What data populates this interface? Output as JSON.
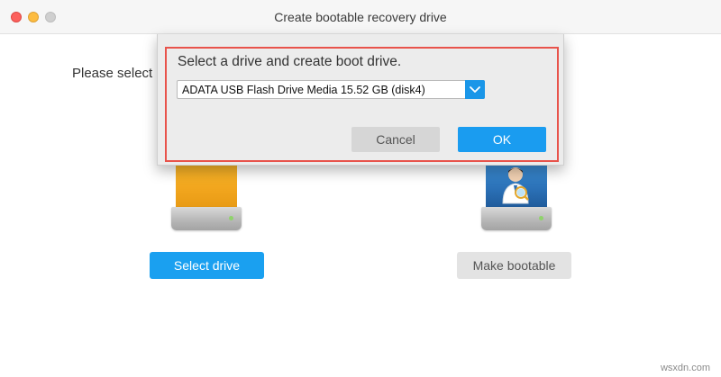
{
  "window": {
    "title": "Create bootable recovery drive"
  },
  "main": {
    "prompt": "Please select",
    "select_drive_label": "Select drive",
    "make_bootable_label": "Make bootable"
  },
  "dialog": {
    "heading": "Select a drive and create boot drive.",
    "drive_dropdown": {
      "selected": "ADATA USB Flash Drive Media 15.52 GB (disk4)"
    },
    "cancel_label": "Cancel",
    "ok_label": "OK"
  },
  "watermark": "wsxdn.com",
  "colors": {
    "accent": "#1a9cf0",
    "highlight_border": "#e8534b",
    "drive_orange": "#f1a51d"
  },
  "icons": {
    "dropdown": "chevron-down-icon",
    "source_drive": "orange-drive-icon",
    "target_drive": "doctor-drive-icon"
  }
}
